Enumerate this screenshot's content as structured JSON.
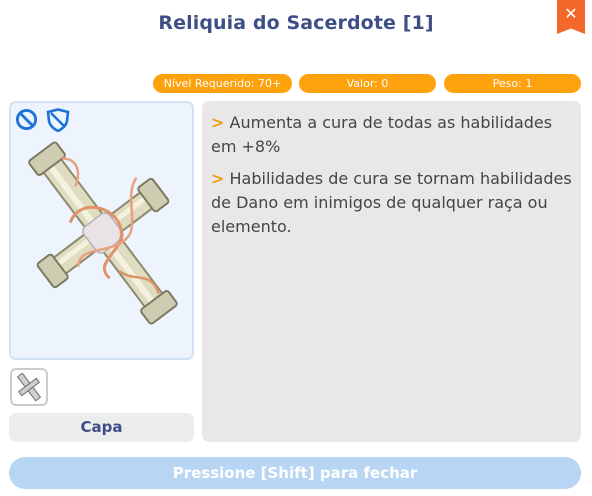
{
  "window": {
    "title": "Reliquia do Sacerdote [1]",
    "close_label": "✕"
  },
  "stats": {
    "required_level": "Nível Requerido: 70+",
    "value": "Valor: 0",
    "weight": "Peso: 1"
  },
  "item": {
    "icons": [
      "no-entry-icon",
      "shield-icon"
    ],
    "slot_type": "Capa"
  },
  "description": [
    {
      "marker": ">",
      "text": "Aumenta a cura de todas as habilidades em +8%"
    },
    {
      "marker": ">",
      "text": "Habilidades de cura se tornam habilidades de Dano em inimigos de qualquer raça ou elemento."
    }
  ],
  "footer": {
    "close_hint": "Pressione [Shift] para fechar"
  },
  "colors": {
    "title": "#3d4f86",
    "pill": "#fda10d",
    "close": "#f3672a",
    "accent_marker": "#f39a17",
    "footer_button": "#b8d5f3"
  }
}
